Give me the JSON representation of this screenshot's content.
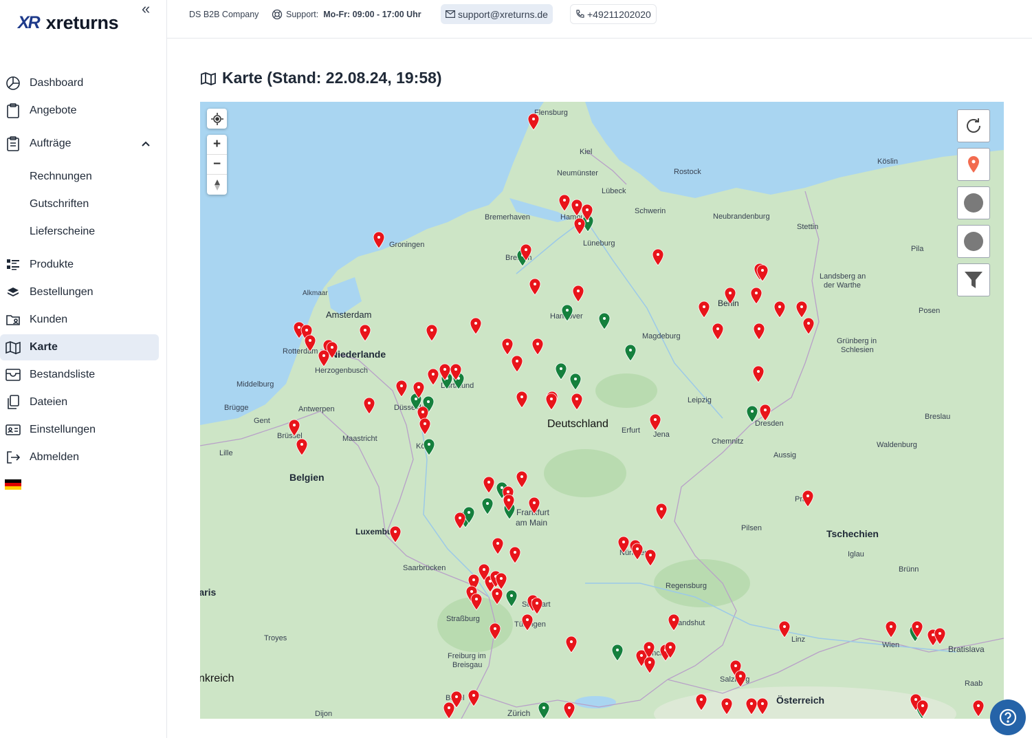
{
  "sidebar": {
    "logo_mark": "XR",
    "logo_text": "xreturns",
    "items": [
      {
        "label": "Dashboard",
        "icon": "dashboard-icon"
      },
      {
        "label": "Angebote",
        "icon": "clipboard-icon"
      },
      {
        "label": "Aufträge",
        "icon": "clipboard-list-icon"
      },
      {
        "label": "Rechnungen"
      },
      {
        "label": "Gutschriften"
      },
      {
        "label": "Lieferscheine"
      },
      {
        "label": "Produkte",
        "icon": "list-icon"
      },
      {
        "label": "Bestellungen",
        "icon": "layers-icon"
      },
      {
        "label": "Kunden",
        "icon": "folder-user-icon"
      },
      {
        "label": "Karte",
        "icon": "map-icon",
        "active": true
      },
      {
        "label": "Bestandsliste",
        "icon": "inbox-icon"
      },
      {
        "label": "Dateien",
        "icon": "files-icon"
      },
      {
        "label": "Einstellungen",
        "icon": "id-card-icon"
      },
      {
        "label": "Abmelden",
        "icon": "logout-icon"
      }
    ]
  },
  "topbar": {
    "company": "DS B2B Company",
    "support_label": "Support:",
    "support_hours": "Mo-Fr: 09:00 - 17:00 Uhr",
    "email": "support@xreturns.de",
    "phone": "+49211202020"
  },
  "page": {
    "title": "Karte (Stand: 22.08.24, 19:58)"
  },
  "map": {
    "labels": [
      {
        "text": "Flensburg"
      },
      {
        "text": "Kiel"
      },
      {
        "text": "Neumünster"
      },
      {
        "text": "Rostock"
      },
      {
        "text": "Köslin"
      },
      {
        "text": "Lübeck"
      },
      {
        "text": "Schwerin"
      },
      {
        "text": "Bremerhaven"
      },
      {
        "text": "Neubrandenburg"
      },
      {
        "text": "Stettin"
      },
      {
        "text": "Groningen"
      },
      {
        "text": "Lüneburg"
      },
      {
        "text": "Pila"
      },
      {
        "text": "Alkmaar"
      },
      {
        "text": "Amsterdam"
      },
      {
        "text": "Landsberg an"
      },
      {
        "text": "der Warthe"
      },
      {
        "text": "Posen"
      },
      {
        "text": "Magdeburg"
      },
      {
        "text": "Niederlande"
      },
      {
        "text": "Rotterdam"
      },
      {
        "text": "Herzogenbusch"
      },
      {
        "text": "Grünberg in"
      },
      {
        "text": "Schlesien"
      },
      {
        "text": "Middelburg"
      },
      {
        "text": "Brügge"
      },
      {
        "text": "Antwerpen"
      },
      {
        "text": "Gent"
      },
      {
        "text": "Leipzig"
      },
      {
        "text": "Breslau"
      },
      {
        "text": "Deutschland"
      },
      {
        "text": "Erfurt"
      },
      {
        "text": "Jena"
      },
      {
        "text": "Dresden"
      },
      {
        "text": "Maastricht"
      },
      {
        "text": "Brüssel"
      },
      {
        "text": "Chemnitz"
      },
      {
        "text": "Waldenburg"
      },
      {
        "text": "Lille"
      },
      {
        "text": "Aussig"
      },
      {
        "text": "Belgien"
      },
      {
        "text": "Prag"
      },
      {
        "text": "Frankfurt"
      },
      {
        "text": "am Main"
      },
      {
        "text": "Luxemburg"
      },
      {
        "text": "Pilsen"
      },
      {
        "text": "Tschechien"
      },
      {
        "text": "Iglau"
      },
      {
        "text": "Saarbrücken"
      },
      {
        "text": "Brünn"
      },
      {
        "text": "Regensburg"
      },
      {
        "text": "Stuttgart"
      },
      {
        "text": "Straßburg"
      },
      {
        "text": "Tübingen"
      },
      {
        "text": "Landshut"
      },
      {
        "text": "Troyes"
      },
      {
        "text": "Linz"
      },
      {
        "text": "Wien"
      },
      {
        "text": "Bratislava"
      },
      {
        "text": "Freiburg im"
      },
      {
        "text": "Breisgau"
      },
      {
        "text": "München"
      },
      {
        "text": "Salzburg"
      },
      {
        "text": "Raab"
      },
      {
        "text": "Basel"
      },
      {
        "text": "Zürich"
      },
      {
        "text": "Dijon"
      },
      {
        "text": "Österreich"
      },
      {
        "text": "Paris"
      },
      {
        "text": "Frankreich"
      },
      {
        "text": "Hamburg"
      },
      {
        "text": "Bremen"
      },
      {
        "text": "Hannover"
      },
      {
        "text": "Berlin"
      },
      {
        "text": "Düsseldorf"
      },
      {
        "text": "Köln"
      },
      {
        "text": "Nürnberg"
      },
      {
        "text": "Dortmund"
      }
    ],
    "colors": {
      "red_pin": "#e8141a",
      "green_pin": "#15803d",
      "water": "#a9d5f1",
      "land": "#cde5c6"
    }
  }
}
